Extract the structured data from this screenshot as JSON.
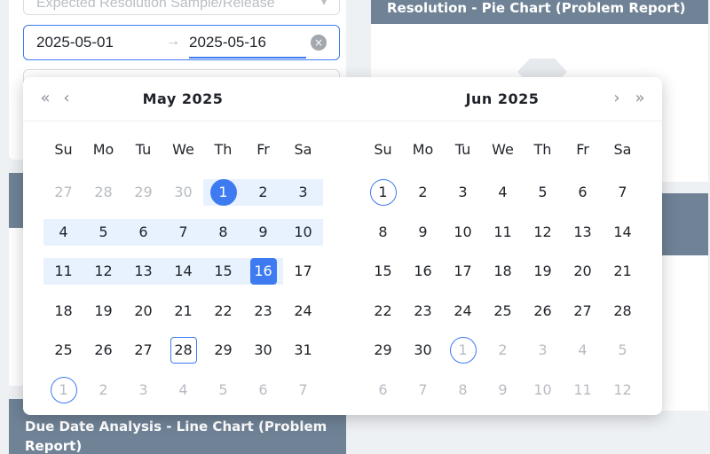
{
  "form": {
    "resolution_placeholder": "Expected Resolution Sample/Release",
    "range_start": "2025-05-01",
    "range_end": "2025-05-16",
    "range_separator": "→",
    "clear_icon": "×"
  },
  "cards": {
    "right_top_title": "Resolution - Pie Chart (Problem Report)",
    "left_bottom_title": "Due Date Analysis - Line Chart (Problem Report)"
  },
  "calendar": {
    "left_title": "May  2025",
    "right_title": "Jun  2025",
    "nav": {
      "prev_year": "«",
      "prev_month": "‹",
      "next_month": "›",
      "next_year": "»"
    },
    "weekdays": [
      "Su",
      "Mo",
      "Tu",
      "We",
      "Th",
      "Fr",
      "Sa"
    ],
    "months": [
      {
        "name": "May 2025",
        "days": [
          {
            "d": "27",
            "muted": true
          },
          {
            "d": "28",
            "muted": true
          },
          {
            "d": "29",
            "muted": true
          },
          {
            "d": "30",
            "muted": true
          },
          {
            "d": "1",
            "state": "range-start"
          },
          {
            "d": "2",
            "state": "in-range"
          },
          {
            "d": "3",
            "state": "in-range"
          },
          {
            "d": "4",
            "state": "in-range"
          },
          {
            "d": "5",
            "state": "in-range"
          },
          {
            "d": "6",
            "state": "in-range"
          },
          {
            "d": "7",
            "state": "in-range"
          },
          {
            "d": "8",
            "state": "in-range"
          },
          {
            "d": "9",
            "state": "in-range"
          },
          {
            "d": "10",
            "state": "in-range"
          },
          {
            "d": "11",
            "state": "in-range"
          },
          {
            "d": "12",
            "state": "in-range"
          },
          {
            "d": "13",
            "state": "in-range"
          },
          {
            "d": "14",
            "state": "in-range"
          },
          {
            "d": "15",
            "state": "in-range"
          },
          {
            "d": "16",
            "state": "range-end"
          },
          {
            "d": "17"
          },
          {
            "d": "18"
          },
          {
            "d": "19"
          },
          {
            "d": "20"
          },
          {
            "d": "21"
          },
          {
            "d": "22"
          },
          {
            "d": "23"
          },
          {
            "d": "24"
          },
          {
            "d": "25"
          },
          {
            "d": "26"
          },
          {
            "d": "27"
          },
          {
            "d": "28",
            "state": "today"
          },
          {
            "d": "29"
          },
          {
            "d": "30"
          },
          {
            "d": "31"
          },
          {
            "d": "1",
            "muted": true,
            "state": "circled"
          },
          {
            "d": "2",
            "muted": true
          },
          {
            "d": "3",
            "muted": true
          },
          {
            "d": "4",
            "muted": true
          },
          {
            "d": "5",
            "muted": true
          },
          {
            "d": "6",
            "muted": true
          },
          {
            "d": "7",
            "muted": true
          }
        ]
      },
      {
        "name": "Jun 2025",
        "days": [
          {
            "d": "1",
            "state": "circled"
          },
          {
            "d": "2"
          },
          {
            "d": "3"
          },
          {
            "d": "4"
          },
          {
            "d": "5"
          },
          {
            "d": "6"
          },
          {
            "d": "7"
          },
          {
            "d": "8"
          },
          {
            "d": "9"
          },
          {
            "d": "10"
          },
          {
            "d": "11"
          },
          {
            "d": "12"
          },
          {
            "d": "13"
          },
          {
            "d": "14"
          },
          {
            "d": "15"
          },
          {
            "d": "16"
          },
          {
            "d": "17"
          },
          {
            "d": "18"
          },
          {
            "d": "19"
          },
          {
            "d": "20"
          },
          {
            "d": "21"
          },
          {
            "d": "22"
          },
          {
            "d": "23"
          },
          {
            "d": "24"
          },
          {
            "d": "25"
          },
          {
            "d": "26"
          },
          {
            "d": "27"
          },
          {
            "d": "28"
          },
          {
            "d": "29"
          },
          {
            "d": "30"
          },
          {
            "d": "1",
            "muted": true,
            "state": "circled"
          },
          {
            "d": "2",
            "muted": true
          },
          {
            "d": "3",
            "muted": true
          },
          {
            "d": "4",
            "muted": true
          },
          {
            "d": "5",
            "muted": true
          },
          {
            "d": "6",
            "muted": true
          },
          {
            "d": "7",
            "muted": true
          },
          {
            "d": "8",
            "muted": true
          },
          {
            "d": "9",
            "muted": true
          },
          {
            "d": "10",
            "muted": true
          },
          {
            "d": "11",
            "muted": true
          },
          {
            "d": "12",
            "muted": true
          }
        ]
      }
    ]
  },
  "colors": {
    "accent": "#3e7bf1",
    "range_fill": "#e8f2ff",
    "card_header": "#6f8296"
  }
}
